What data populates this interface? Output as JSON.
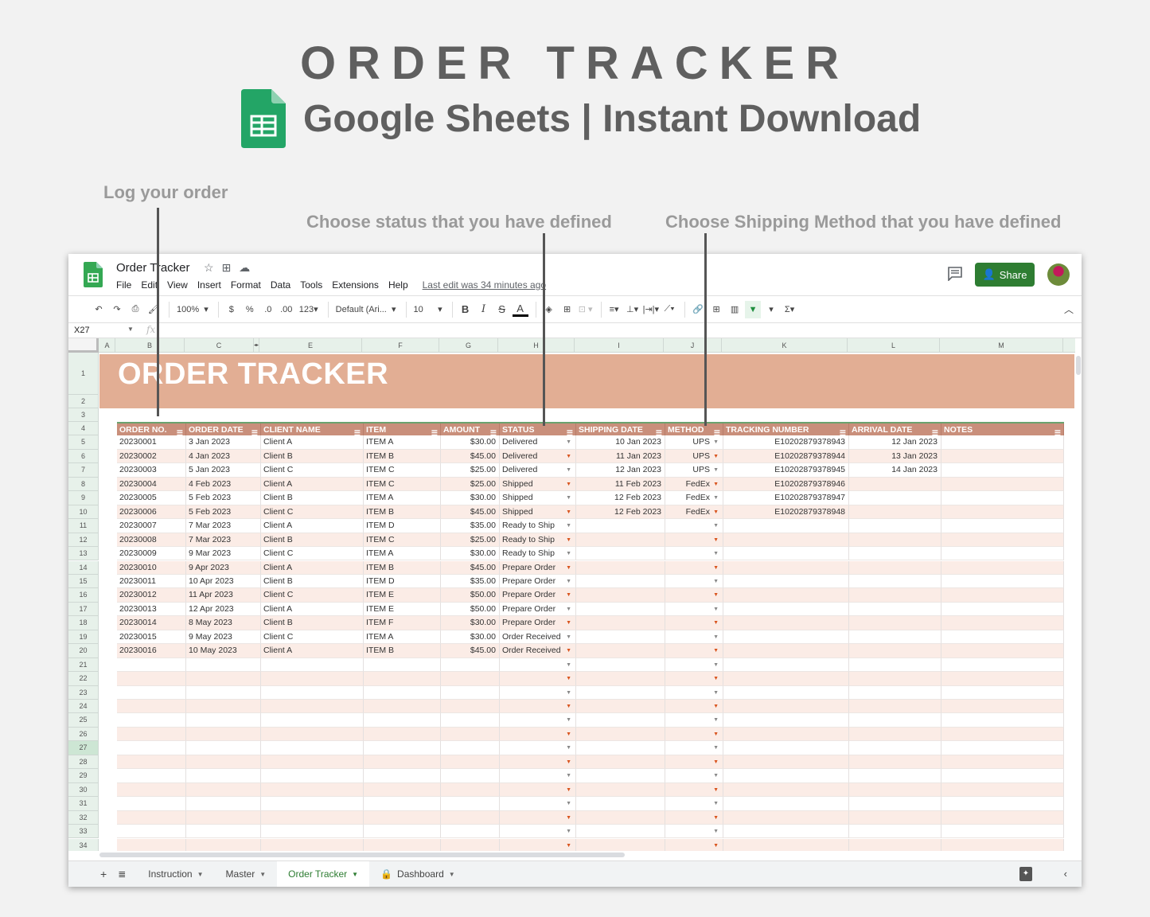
{
  "promo": {
    "title": "ORDER TRACKER",
    "subtitle": "Google Sheets | Instant Download",
    "callouts": {
      "log": "Log your order",
      "status": "Choose status that you have defined",
      "method": "Choose Shipping Method that you have defined"
    }
  },
  "window": {
    "doc_title": "Order Tracker",
    "title_icons": [
      "star-icon",
      "move-to-folder-icon",
      "cloud-status-icon"
    ],
    "menu": [
      "File",
      "Edit",
      "View",
      "Insert",
      "Format",
      "Data",
      "Tools",
      "Extensions",
      "Help"
    ],
    "last_edit": "Last edit was 34 minutes ago",
    "share_label": "Share",
    "accent": "#2e7d32"
  },
  "toolbar": {
    "zoom": "100%",
    "currency": "$",
    "percent": "%",
    "dec_decrease": ".0",
    "dec_increase": ".00",
    "format_more": "123",
    "font": "Default (Ari...",
    "font_size": "10",
    "bold": "B",
    "italic": "I",
    "strike": "S",
    "text_color": "A",
    "sum": "Σ"
  },
  "formula_bar": {
    "name_box": "X27",
    "fx": "fx",
    "value": ""
  },
  "grid": {
    "columns": [
      "A",
      "B",
      "C",
      "",
      "E",
      "F",
      "G",
      "H",
      "I",
      "J",
      "K",
      "L",
      "M"
    ],
    "rows": [
      "1",
      "2",
      "3",
      "4",
      "5",
      "6",
      "7",
      "8",
      "9",
      "10",
      "11",
      "12",
      "13",
      "14",
      "15",
      "16",
      "17",
      "18",
      "19",
      "20",
      "21",
      "22",
      "23",
      "24",
      "25",
      "26",
      "27",
      "28",
      "29",
      "30",
      "31",
      "32",
      "33",
      "34"
    ],
    "selected_row": "27"
  },
  "sheet": {
    "banner_title": "ORDER TRACKER",
    "header_color": "#c98f7b",
    "banner_color": "#e2ae94",
    "stripe_color": "#fbece6",
    "headers": [
      "ORDER NO.",
      "ORDER DATE",
      "CLIENT NAME",
      "ITEM",
      "AMOUNT",
      "STATUS",
      "SHIPPING DATE",
      "METHOD",
      "TRACKING NUMBER",
      "ARRIVAL DATE",
      "NOTES"
    ],
    "orders": [
      [
        "20230001",
        "3 Jan 2023",
        "Client A",
        "ITEM A",
        "$30.00",
        "Delivered",
        "10 Jan 2023",
        "UPS",
        "E10202879378943",
        "12 Jan 2023",
        ""
      ],
      [
        "20230002",
        "4 Jan 2023",
        "Client B",
        "ITEM B",
        "$45.00",
        "Delivered",
        "11 Jan 2023",
        "UPS",
        "E10202879378944",
        "13 Jan 2023",
        ""
      ],
      [
        "20230003",
        "5 Jan 2023",
        "Client C",
        "ITEM C",
        "$25.00",
        "Delivered",
        "12 Jan 2023",
        "UPS",
        "E10202879378945",
        "14 Jan 2023",
        ""
      ],
      [
        "20230004",
        "4 Feb 2023",
        "Client A",
        "ITEM C",
        "$25.00",
        "Shipped",
        "11 Feb 2023",
        "FedEx",
        "E10202879378946",
        "",
        ""
      ],
      [
        "20230005",
        "5 Feb 2023",
        "Client B",
        "ITEM A",
        "$30.00",
        "Shipped",
        "12 Feb 2023",
        "FedEx",
        "E10202879378947",
        "",
        ""
      ],
      [
        "20230006",
        "5 Feb 2023",
        "Client C",
        "ITEM B",
        "$45.00",
        "Shipped",
        "12 Feb 2023",
        "FedEx",
        "E10202879378948",
        "",
        ""
      ],
      [
        "20230007",
        "7 Mar 2023",
        "Client A",
        "ITEM D",
        "$35.00",
        "Ready to Ship",
        "",
        "",
        "",
        "",
        ""
      ],
      [
        "20230008",
        "7 Mar 2023",
        "Client B",
        "ITEM C",
        "$25.00",
        "Ready to Ship",
        "",
        "",
        "",
        "",
        ""
      ],
      [
        "20230009",
        "9 Mar 2023",
        "Client C",
        "ITEM A",
        "$30.00",
        "Ready to Ship",
        "",
        "",
        "",
        "",
        ""
      ],
      [
        "20230010",
        "9 Apr 2023",
        "Client A",
        "ITEM B",
        "$45.00",
        "Prepare Order",
        "",
        "",
        "",
        "",
        ""
      ],
      [
        "20230011",
        "10 Apr 2023",
        "Client B",
        "ITEM D",
        "$35.00",
        "Prepare Order",
        "",
        "",
        "",
        "",
        ""
      ],
      [
        "20230012",
        "11 Apr 2023",
        "Client C",
        "ITEM E",
        "$50.00",
        "Prepare Order",
        "",
        "",
        "",
        "",
        ""
      ],
      [
        "20230013",
        "12 Apr 2023",
        "Client A",
        "ITEM E",
        "$50.00",
        "Prepare Order",
        "",
        "",
        "",
        "",
        ""
      ],
      [
        "20230014",
        "8 May 2023",
        "Client B",
        "ITEM F",
        "$30.00",
        "Prepare Order",
        "",
        "",
        "",
        "",
        ""
      ],
      [
        "20230015",
        "9 May 2023",
        "Client C",
        "ITEM A",
        "$30.00",
        "Order Received",
        "",
        "",
        "",
        "",
        ""
      ],
      [
        "20230016",
        "10 May 2023",
        "Client A",
        "ITEM B",
        "$45.00",
        "Order Received",
        "",
        "",
        "",
        "",
        ""
      ]
    ],
    "empty_rows": 14
  },
  "sheet_tabs": [
    {
      "label": "Instruction",
      "active": false,
      "locked": false
    },
    {
      "label": "Master",
      "active": false,
      "locked": false
    },
    {
      "label": "Order Tracker",
      "active": true,
      "locked": false
    },
    {
      "label": "Dashboard",
      "active": false,
      "locked": true
    }
  ]
}
